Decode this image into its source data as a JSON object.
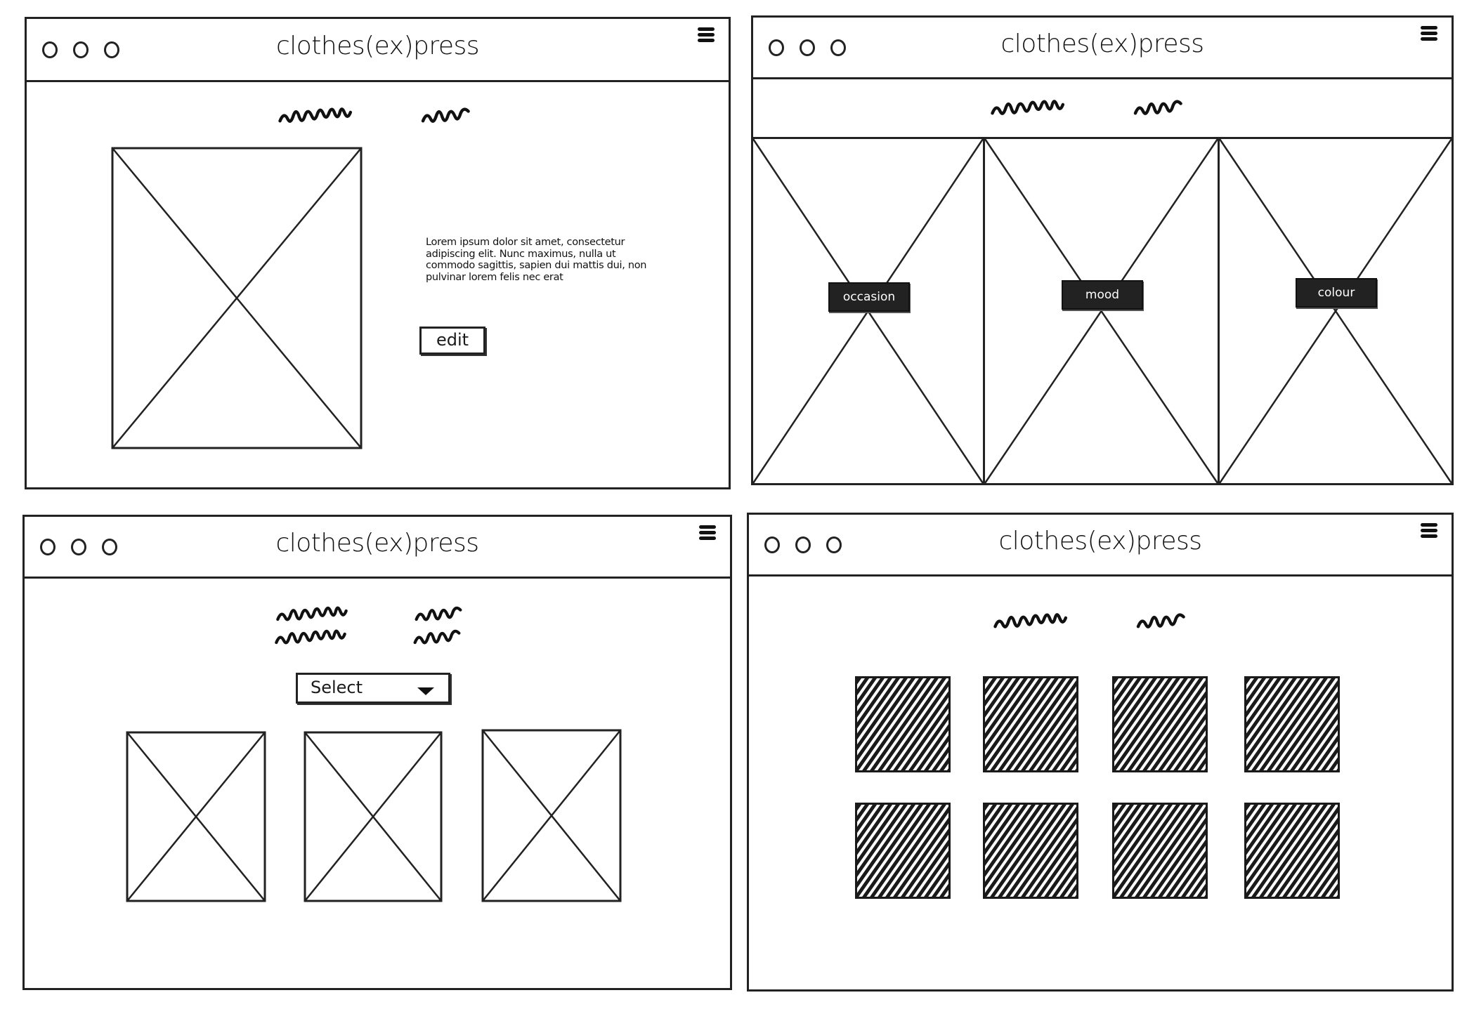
{
  "app": {
    "title": "clothes(ex)press"
  },
  "icons": {
    "window_controls": "window-control-circle",
    "menu": "hamburger-menu-icon",
    "image_placeholder": "image-placeholder-x",
    "dropdown": "caret-down-icon"
  },
  "screens": {
    "detail": {
      "title": "clothes(ex)press",
      "heading_placeholder": "scribble heading",
      "description": [
        "Lorem ipsum dolor sit amet, consectetur",
        "adipiscing elit. Nunc maximus, nulla ut",
        "commodo sagittis, sapien dui mattis dui, non",
        "pulvinar lorem felis nec erat"
      ],
      "edit_label": "edit"
    },
    "categories": {
      "title": "clothes(ex)press",
      "heading_placeholder": "scribble heading",
      "panels": [
        {
          "label": "occasion"
        },
        {
          "label": "mood"
        },
        {
          "label": "colour"
        }
      ]
    },
    "browse": {
      "title": "clothes(ex)press",
      "heading_placeholder": "scribble heading (two lines)",
      "select_label": "Select",
      "items": [
        {
          "type": "image"
        },
        {
          "type": "image"
        },
        {
          "type": "image"
        }
      ]
    },
    "colours": {
      "title": "clothes(ex)press",
      "heading_placeholder": "scribble heading",
      "swatches": [
        {
          "color": "#d9d9d9"
        },
        {
          "color": "#e3c3c3"
        },
        {
          "color": "#cfcfcf"
        },
        {
          "color": "#8a6e66"
        },
        {
          "color": "#ddb1b4"
        },
        {
          "color": "#9fb2bf"
        },
        {
          "color": "#a8a8a8"
        },
        {
          "color": "#d8d3bf"
        }
      ]
    }
  }
}
